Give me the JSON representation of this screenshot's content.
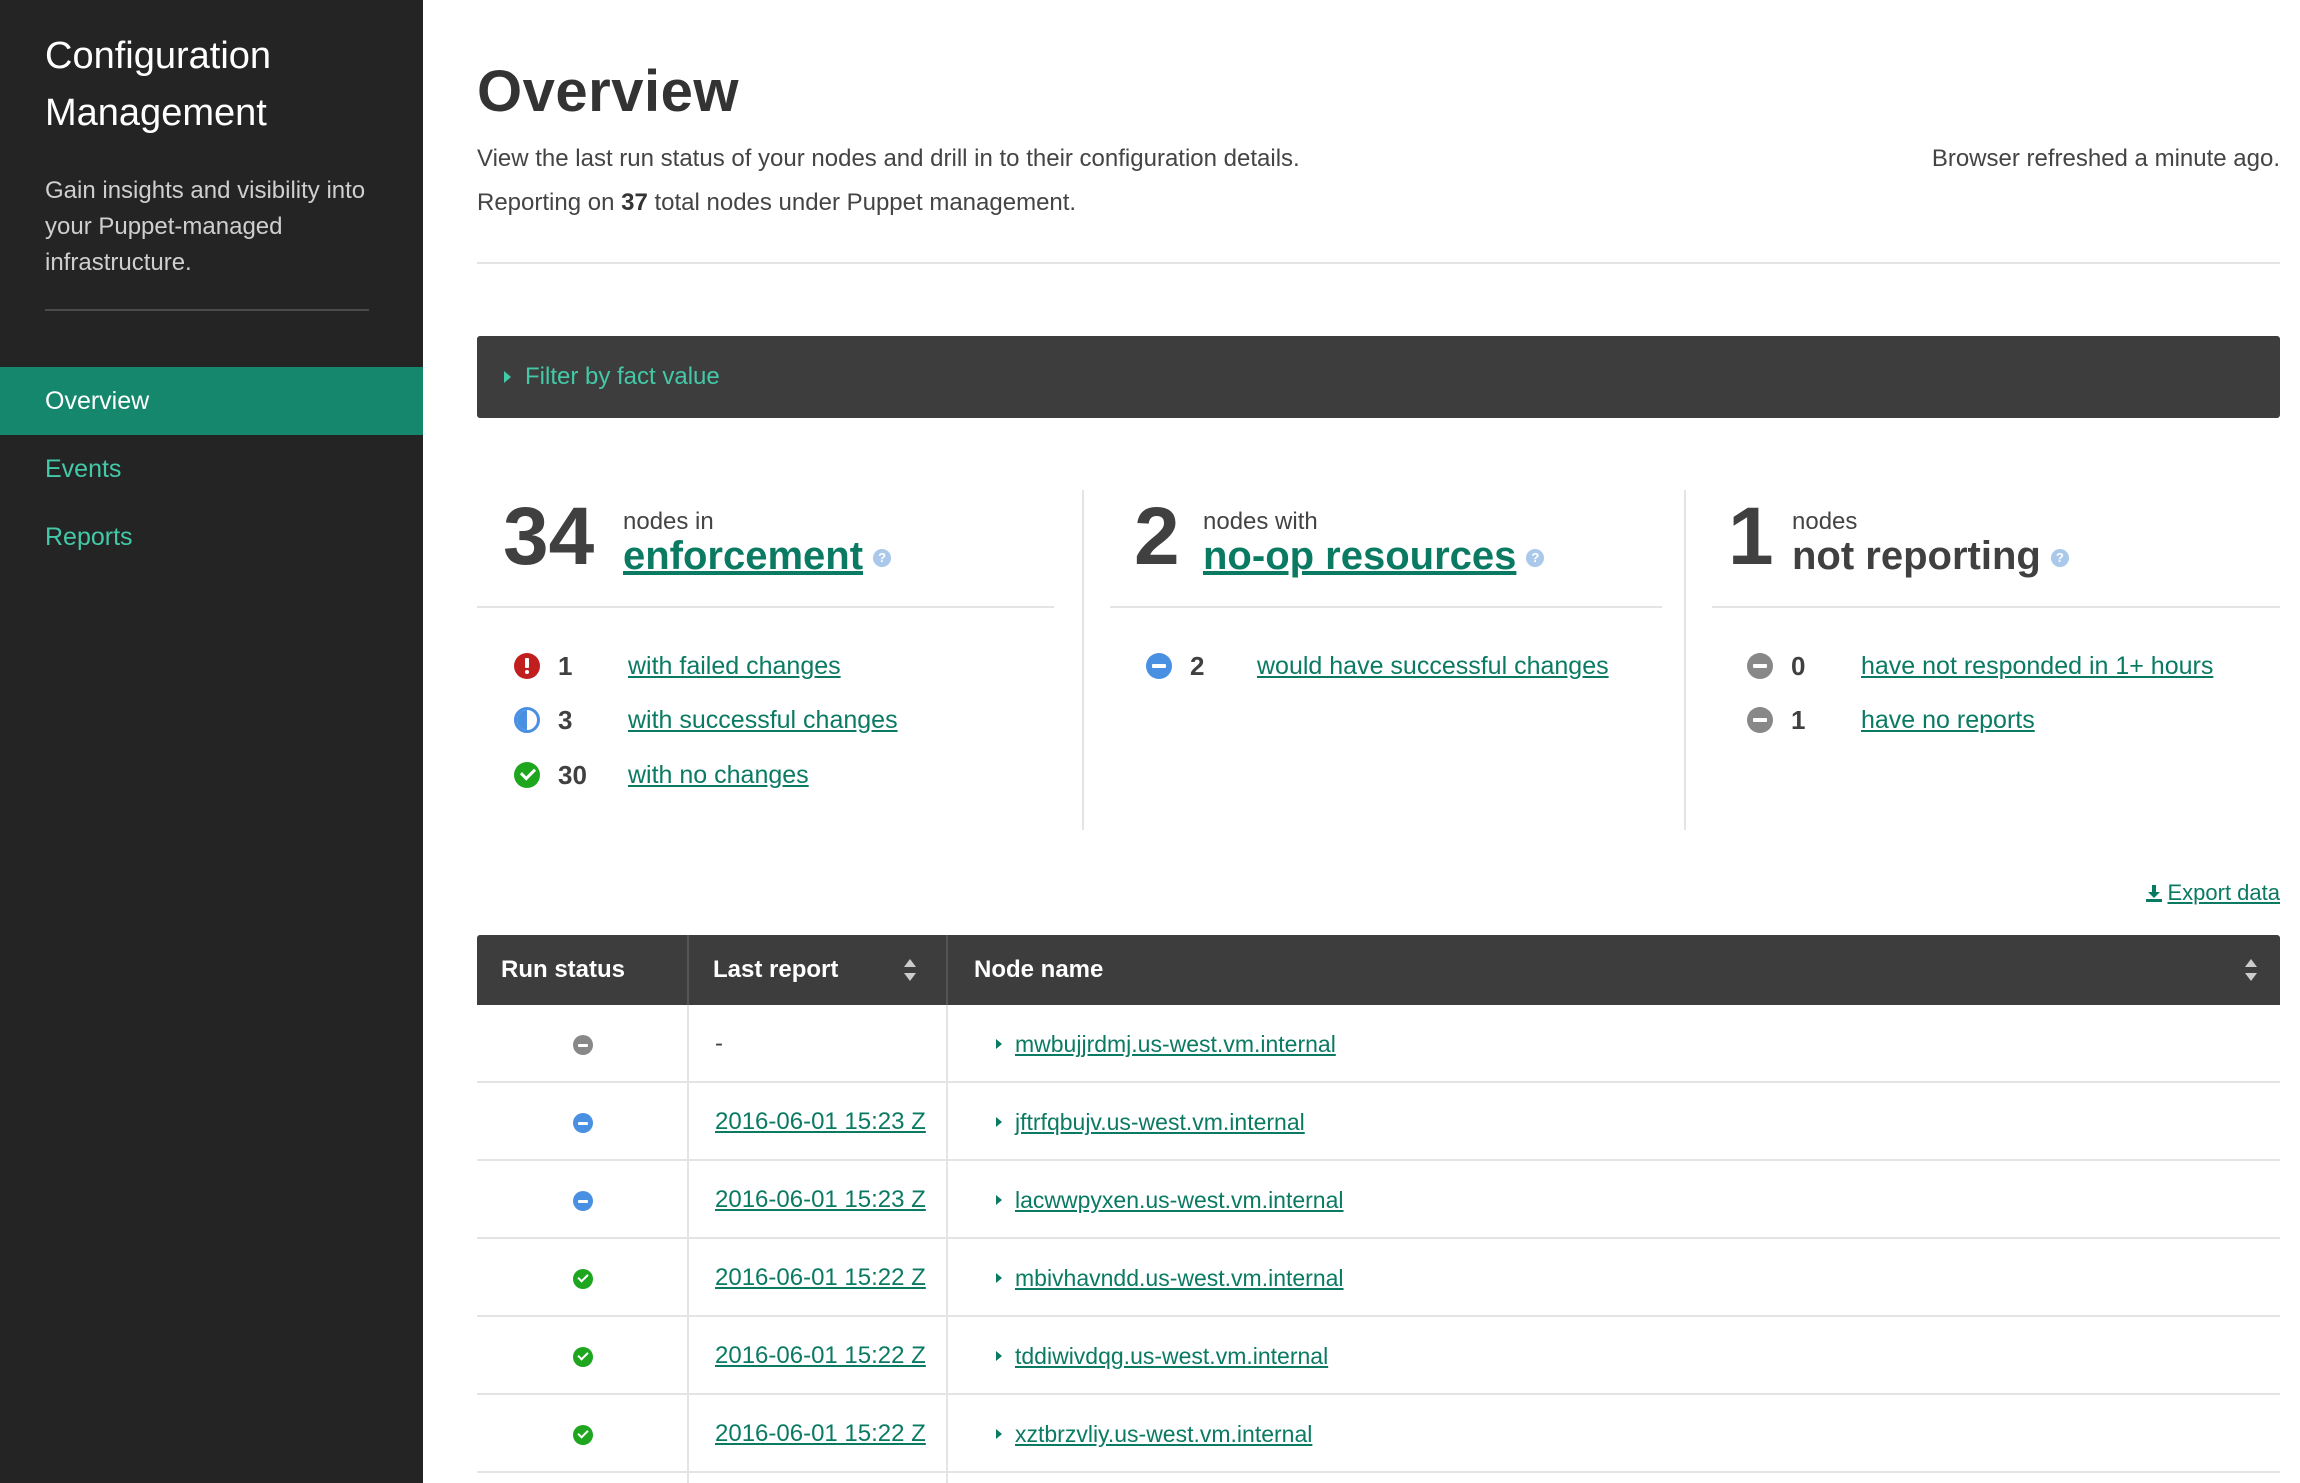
{
  "sidebar": {
    "title_line1": "Configuration",
    "title_line2": "Management",
    "description": "Gain insights and visibility into your Puppet-managed infrastructure.",
    "items": [
      {
        "label": "Overview",
        "active": true
      },
      {
        "label": "Events",
        "active": false
      },
      {
        "label": "Reports",
        "active": false
      }
    ]
  },
  "header": {
    "title": "Overview",
    "subtitle": "View the last run status of your nodes and drill in to their configuration details.",
    "refresh_status": "Browser refreshed a minute ago.",
    "reporting_prefix": "Reporting on ",
    "reporting_count": "37",
    "reporting_suffix": " total nodes under Puppet management."
  },
  "filter": {
    "label": "Filter by fact value",
    "icon": "caret-right-icon"
  },
  "summary": {
    "enforcement": {
      "count": "34",
      "small_label": "nodes in",
      "heading": "enforcement",
      "help_icon": "question-circle-icon",
      "rows": [
        {
          "icon": "failed-icon",
          "count": "1",
          "label": "with failed changes"
        },
        {
          "icon": "half-circle-icon",
          "count": "3",
          "label": "with successful changes"
        },
        {
          "icon": "check-circle-icon",
          "count": "30",
          "label": "with no changes"
        }
      ]
    },
    "noop": {
      "count": "2",
      "small_label": "nodes with",
      "heading": "no-op resources",
      "help_icon": "question-circle-icon",
      "rows": [
        {
          "icon": "noop-minus-icon",
          "count": "2",
          "label": "would have successful changes"
        }
      ]
    },
    "not_reporting": {
      "count": "1",
      "small_label": "nodes",
      "heading": "not reporting",
      "help_icon": "question-circle-icon",
      "rows": [
        {
          "icon": "gray-minus-icon",
          "count": "0",
          "label": "have not responded in 1+ hours"
        },
        {
          "icon": "gray-minus-icon",
          "count": "1",
          "label": "have no reports"
        }
      ]
    }
  },
  "export": {
    "label": "Export data",
    "icon": "download-icon"
  },
  "table": {
    "columns": [
      "Run status",
      "Last report",
      "Node name"
    ],
    "rows": [
      {
        "status": "unreported",
        "last_report": "-",
        "node": "mwbujjrdmj.us-west.vm.internal"
      },
      {
        "status": "noop",
        "last_report": "2016-06-01 15:23 Z",
        "node": "jftrfqbujv.us-west.vm.internal"
      },
      {
        "status": "noop",
        "last_report": "2016-06-01 15:23 Z",
        "node": "lacwwpyxen.us-west.vm.internal"
      },
      {
        "status": "unchanged",
        "last_report": "2016-06-01 15:22 Z",
        "node": "mbivhavndd.us-west.vm.internal"
      },
      {
        "status": "unchanged",
        "last_report": "2016-06-01 15:22 Z",
        "node": "tddiwivdqg.us-west.vm.internal"
      },
      {
        "status": "unchanged",
        "last_report": "2016-06-01 15:22 Z",
        "node": "xztbrzvliy.us-west.vm.internal"
      }
    ]
  },
  "colors": {
    "sidebar_bg": "#242424",
    "active_nav": "#15876d",
    "accent_link": "#0b7a63",
    "nav_link": "#43c9a8",
    "failed": "#c11f1f",
    "success": "#1ea61e",
    "noop": "#4a90e2",
    "neutral": "#888888"
  }
}
